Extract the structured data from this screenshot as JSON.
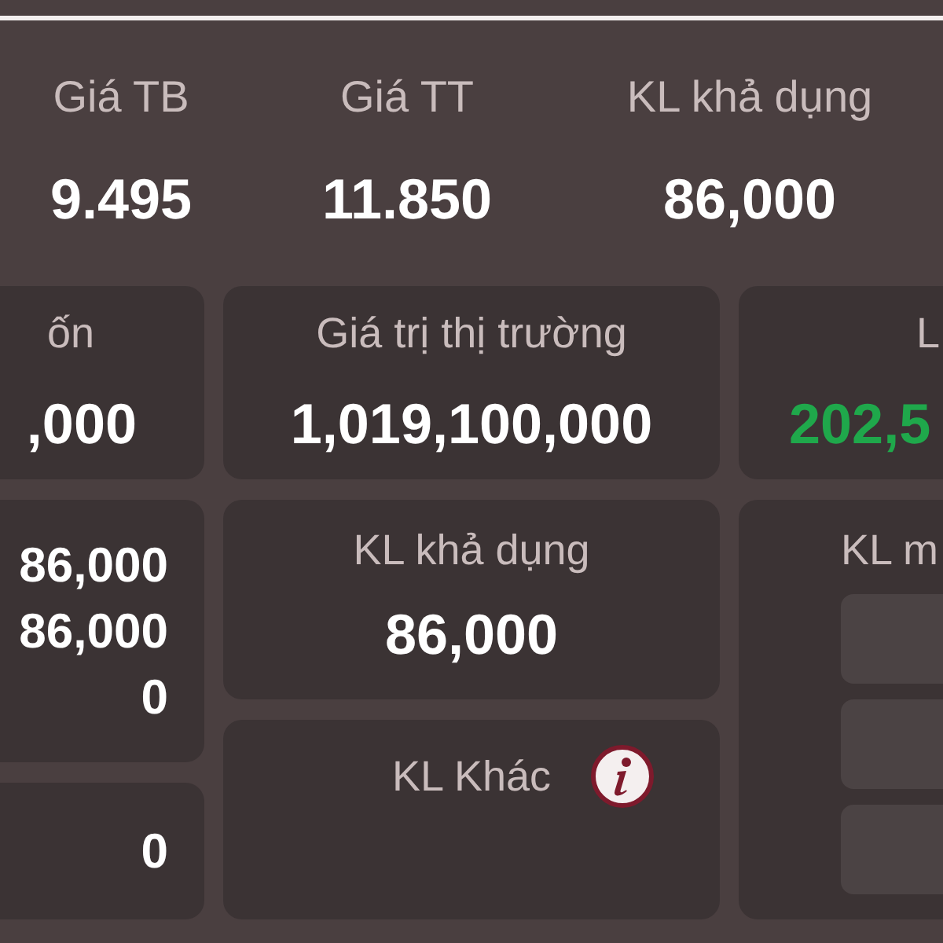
{
  "summary": [
    {
      "label": "Giá TB",
      "value": "9.495"
    },
    {
      "label": "Giá TT",
      "value": "11.850"
    },
    {
      "label": "KL khả dụng",
      "value": "86,000"
    }
  ],
  "top_cards": [
    {
      "label": "ốn",
      "value": ",000",
      "kind": "plain"
    },
    {
      "label": "Giá trị thị trường",
      "value": "1,019,100,000",
      "kind": "plain"
    },
    {
      "label": "L",
      "value": "202,5",
      "kind": "gain"
    }
  ],
  "left_column": [
    {
      "values": [
        "86,000",
        "86,000",
        "0"
      ]
    },
    {
      "values": [
        "0"
      ]
    }
  ],
  "middle_column": [
    {
      "label": "KL khả dụng",
      "value": "86,000",
      "info": false
    },
    {
      "label": "KL Khác",
      "info": true
    }
  ],
  "right_card": {
    "label": "KL m",
    "slots": [
      {
        "kind": "empty"
      },
      {
        "kind": "empty"
      },
      {
        "kind": "empty"
      }
    ]
  }
}
